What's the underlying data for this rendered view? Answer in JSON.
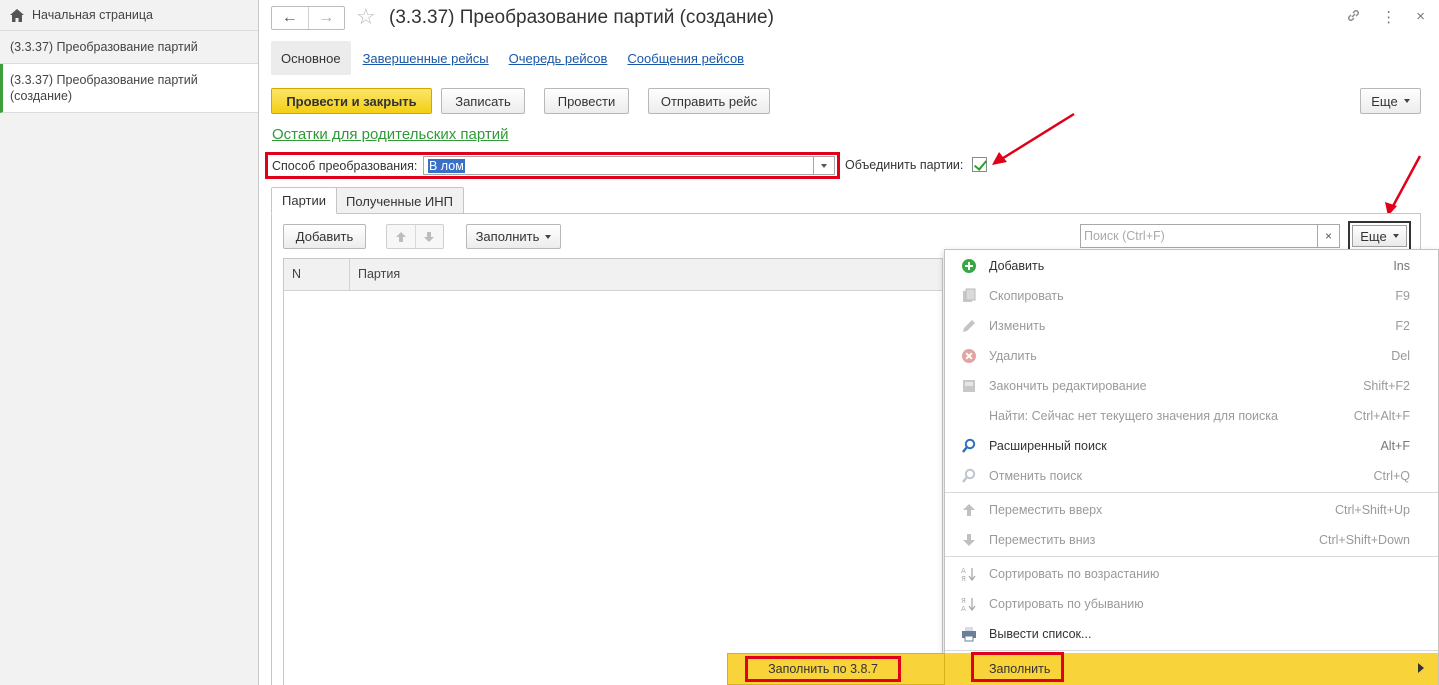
{
  "sidebar": {
    "home": "Начальная страница",
    "items": [
      {
        "label": "(3.3.37) Преобразование партий"
      },
      {
        "label": "(3.3.37) Преобразование партий (создание)"
      }
    ]
  },
  "header": {
    "back_icon": "←",
    "forward_icon": "→",
    "star_icon": "☆",
    "title": "(3.3.37) Преобразование партий (создание)",
    "link_icon": "🔗",
    "menu_icon": "⋮",
    "close_icon": "×"
  },
  "tabs": {
    "active": "Основное",
    "links": [
      "Завершенные рейсы",
      "Очередь рейсов",
      "Сообщения рейсов"
    ]
  },
  "toolbar": {
    "post_close": "Провести и закрыть",
    "save": "Записать",
    "post": "Провести",
    "send": "Отправить рейс",
    "more": "Еще"
  },
  "parent_link": "Остатки для родительских партий",
  "field": {
    "label": "Способ преобразования:",
    "value": "В лом",
    "merge_label": "Объединить партии:",
    "merge_checked": true
  },
  "inner_tabs": [
    "Партии",
    "Полученные ИНП"
  ],
  "table_toolbar": {
    "add": "Добавить",
    "up_icon": "🡅",
    "down_icon": "🡇",
    "fill": "Заполнить",
    "search_placeholder": "Поиск (Ctrl+F)",
    "clear_icon": "×",
    "more": "Еще"
  },
  "table": {
    "columns": [
      "N",
      "Партия"
    ]
  },
  "menu": {
    "items": [
      {
        "label": "Добавить",
        "shortcut": "Ins",
        "enabled": true,
        "icon": "add-icon"
      },
      {
        "label": "Скопировать",
        "shortcut": "F9",
        "enabled": false,
        "icon": "copy-icon"
      },
      {
        "label": "Изменить",
        "shortcut": "F2",
        "enabled": false,
        "icon": "edit-icon"
      },
      {
        "label": "Удалить",
        "shortcut": "Del",
        "enabled": false,
        "icon": "delete-icon"
      },
      {
        "label": "Закончить редактирование",
        "shortcut": "Shift+F2",
        "enabled": false,
        "icon": "end-edit-icon"
      },
      {
        "label": "Найти: Сейчас нет текущего значения для поиска",
        "shortcut": "Ctrl+Alt+F",
        "enabled": false,
        "icon": ""
      },
      {
        "label": "Расширенный поиск",
        "shortcut": "Alt+F",
        "enabled": true,
        "icon": "search-icon"
      },
      {
        "label": "Отменить поиск",
        "shortcut": "Ctrl+Q",
        "enabled": false,
        "icon": "cancel-search-icon"
      },
      {
        "label": "Переместить вверх",
        "shortcut": "Ctrl+Shift+Up",
        "enabled": false,
        "icon": "move-up-icon"
      },
      {
        "label": "Переместить вниз",
        "shortcut": "Ctrl+Shift+Down",
        "enabled": false,
        "icon": "move-down-icon"
      },
      {
        "label": "Сортировать по возрастанию",
        "shortcut": "",
        "enabled": false,
        "icon": "sort-asc-icon"
      },
      {
        "label": "Сортировать по убыванию",
        "shortcut": "",
        "enabled": false,
        "icon": "sort-desc-icon"
      },
      {
        "label": "Вывести список...",
        "shortcut": "",
        "enabled": true,
        "icon": "list-output-icon"
      },
      {
        "label": "Заполнить",
        "shortcut": "",
        "enabled": true,
        "icon": "",
        "submenu": true
      }
    ]
  },
  "submenu": {
    "item": "Заполнить по 3.8.7"
  },
  "colors": {
    "accent_yellow": "#f9d33a",
    "highlight_red": "#e0001a",
    "link_blue": "#1a57a6",
    "link_green": "#2f9a37"
  }
}
